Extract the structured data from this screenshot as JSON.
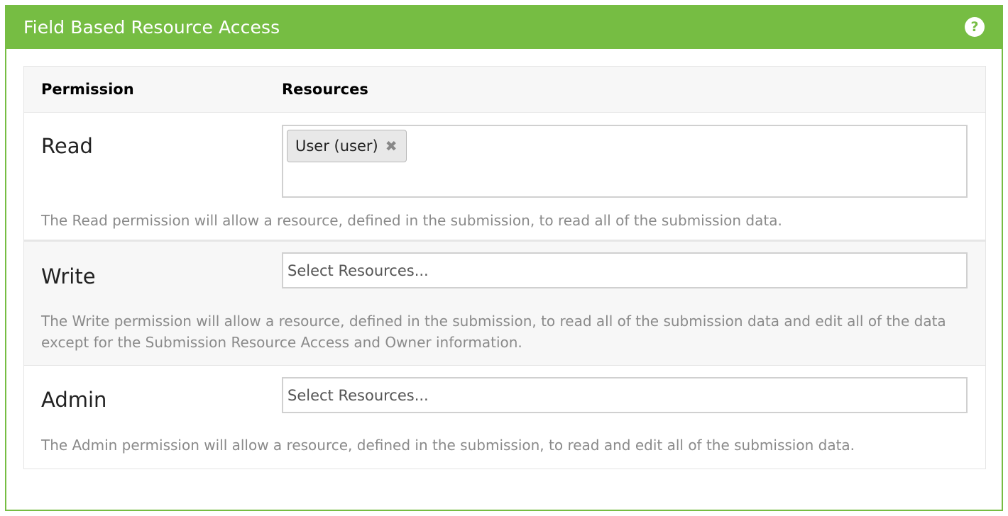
{
  "panel": {
    "title": "Field Based Resource Access",
    "help_icon": "question-circle-icon",
    "accent_color": "#76bd43"
  },
  "table": {
    "headers": {
      "permission": "Permission",
      "resources": "Resources"
    },
    "rows": [
      {
        "permission": "Read",
        "selected": [
          {
            "label": "User (user)",
            "remove_symbol": "✖"
          }
        ],
        "placeholder": "",
        "description": "The Read permission will allow a resource, defined in the submission, to read all of the submission data."
      },
      {
        "permission": "Write",
        "selected": [],
        "placeholder": "Select Resources...",
        "description": "The Write permission will allow a resource, defined in the submission, to read all of the submission data and edit all of the data except for the Submission Resource Access and Owner information."
      },
      {
        "permission": "Admin",
        "selected": [],
        "placeholder": "Select Resources...",
        "description": "The Admin permission will allow a resource, defined in the submission, to read and edit all of the submission data."
      }
    ]
  }
}
